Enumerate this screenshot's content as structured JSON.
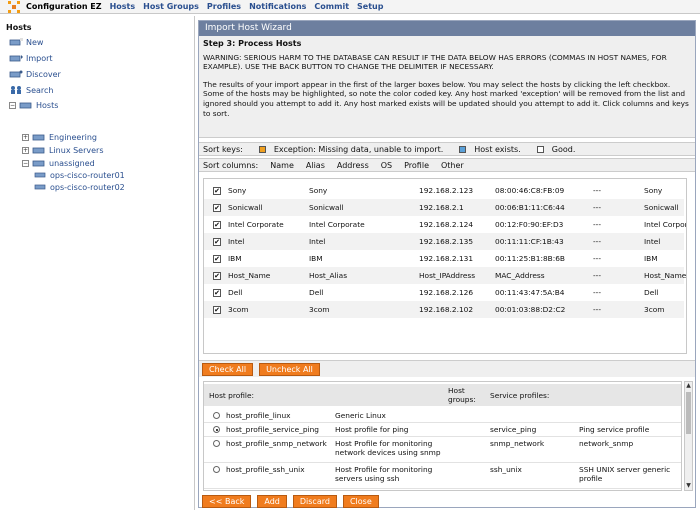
{
  "app": {
    "brand": "Configuration EZ"
  },
  "topnav": [
    "Hosts",
    "Host Groups",
    "Profiles",
    "Notifications",
    "Commit",
    "Setup"
  ],
  "sidebar": {
    "title": "Hosts",
    "items": [
      {
        "label": "New",
        "icon": "new-host-icon"
      },
      {
        "label": "Import",
        "icon": "import-icon"
      },
      {
        "label": "Discover",
        "icon": "discover-icon"
      },
      {
        "label": "Search",
        "icon": "search-icon"
      },
      {
        "label": "Hosts",
        "icon": "hosts-icon"
      },
      {
        "label": "Engineering",
        "icon": "group-icon"
      },
      {
        "label": "Linux Servers",
        "icon": "group-icon"
      },
      {
        "label": "unassigned",
        "icon": "group-icon"
      },
      {
        "label": "ops-cisco-router01",
        "icon": "host-icon"
      },
      {
        "label": "ops-cisco-router02",
        "icon": "host-icon"
      }
    ]
  },
  "wizard": {
    "title": "Import Host Wizard",
    "step": "Step 3: Process Hosts",
    "warning": "WARNING: SERIOUS HARM TO THE DATABASE CAN RESULT IF THE DATA BELOW HAS ERRORS (COMMAS IN HOST NAMES, FOR EXAMPLE). USE THE BACK BUTTON TO CHANGE THE DELIMITER IF NECESSARY.",
    "info": "The results of your import appear in the first of the larger boxes below. You may select the hosts by clicking the left checkbox. Some of the hosts may be highlighted, so note the color coded key. Any host marked 'exception' will be removed from the list and ignored should you attempt to add it. Any host marked exists will be updated should you attempt to add it. Click columns and keys to sort."
  },
  "sort_keys": {
    "label": "Sort keys:",
    "keys": [
      {
        "label": "Exception: Missing data, unable to import.",
        "color": "#f0a020"
      },
      {
        "label": "Host exists.",
        "color": "#5aa0d8"
      },
      {
        "label": "Good.",
        "color": "#ffffff"
      }
    ]
  },
  "sort_columns": {
    "label": "Sort columns:",
    "columns": [
      "Name",
      "Alias",
      "Address",
      "OS",
      "Profile",
      "Other"
    ]
  },
  "hosts": [
    {
      "checked": "✔",
      "name": "Sony",
      "alias": "Sony",
      "address": "192.168.2.123",
      "mac": "08:00:46:C8:FB:09",
      "os": "---",
      "profile": "Sony"
    },
    {
      "checked": "✔",
      "name": "Sonicwall",
      "alias": "Sonicwall",
      "address": "192.168.2.1",
      "mac": "00:06:B1:11:C6:44",
      "os": "---",
      "profile": "Sonicwall"
    },
    {
      "checked": "✔",
      "name": "Intel Corporate",
      "alias": "Intel Corporate",
      "address": "192.168.2.124",
      "mac": "00:12:F0:90:EF:D3",
      "os": "---",
      "profile": "Intel Corporate"
    },
    {
      "checked": "✔",
      "name": "Intel",
      "alias": "Intel",
      "address": "192.168.2.135",
      "mac": "00:11:11:CF:1B:43",
      "os": "---",
      "profile": "Intel"
    },
    {
      "checked": "✔",
      "name": "IBM",
      "alias": "IBM",
      "address": "192.168.2.131",
      "mac": "00:11:25:B1:8B:6B",
      "os": "---",
      "profile": "IBM"
    },
    {
      "checked": "✔",
      "name": "Host_Name",
      "alias": "Host_Alias",
      "address": "Host_IPAddress",
      "mac": "MAC_Address",
      "os": "---",
      "profile": "Host_Name"
    },
    {
      "checked": "✔",
      "name": "Dell",
      "alias": "Dell",
      "address": "192.168.2.126",
      "mac": "00:11:43:47:5A:B4",
      "os": "---",
      "profile": "Dell"
    },
    {
      "checked": "✔",
      "name": "3com",
      "alias": "3com",
      "address": "192.168.2.102",
      "mac": "00:01:03:88:D2:C2",
      "os": "---",
      "profile": "3com"
    }
  ],
  "buttons": {
    "check_all": "Check All",
    "uncheck_all": "Uncheck All",
    "back": "<< Back",
    "add": "Add",
    "discard": "Discard",
    "close": "Close"
  },
  "profiles": {
    "headers": {
      "host_profile": "Host profile:",
      "host_groups": "Host groups:",
      "service_profiles": "Service profiles:"
    },
    "rows": [
      {
        "selected": false,
        "name": "host_profile_linux",
        "desc": "Generic Linux",
        "service": "",
        "service_desc": ""
      },
      {
        "selected": true,
        "name": "host_profile_service_ping",
        "desc": "Host profile for ping",
        "service": "service_ping",
        "service_desc": "Ping service profile"
      },
      {
        "selected": false,
        "name": "host_profile_snmp_network",
        "desc": "Host Profile for monitoring network devices using snmp",
        "service": "snmp_network",
        "service_desc": "network_snmp"
      },
      {
        "selected": false,
        "name": "host_profile_ssh_unix",
        "desc": "Host Profile for monitoring servers using ssh",
        "service": "ssh_unix",
        "service_desc": "SSH UNIX server generic profile"
      }
    ]
  }
}
